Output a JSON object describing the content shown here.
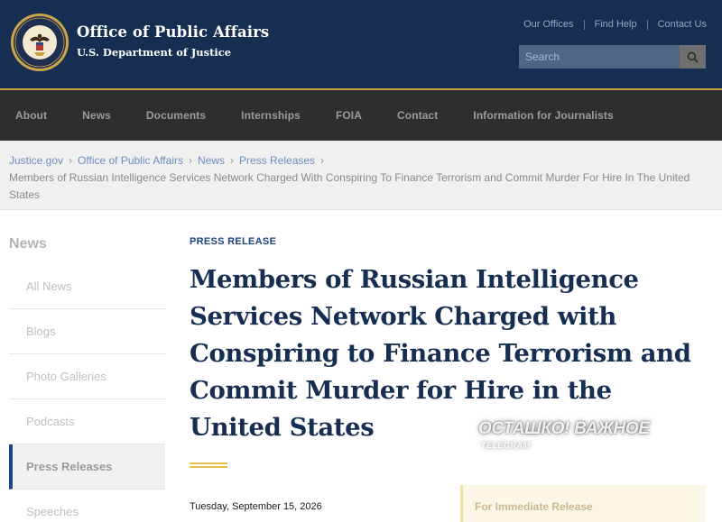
{
  "header": {
    "title": "Office of Public Affairs",
    "subtitle": "U.S. Department of Justice",
    "seal_icon": "doj-seal-icon",
    "utility_links": [
      "Our Offices",
      "Find Help",
      "Contact Us"
    ],
    "search": {
      "placeholder": "Search",
      "icon": "search-icon"
    },
    "colors": {
      "header_bg": "#162e51",
      "accent_gold": "#c5a545"
    }
  },
  "nav": {
    "items": [
      "About",
      "News",
      "Documents",
      "Internships",
      "FOIA",
      "Contact",
      "Information for Journalists"
    ]
  },
  "breadcrumb": {
    "links": [
      "Justice.gov",
      "Office of Public Affairs",
      "News",
      "Press Releases"
    ],
    "current": "Members of Russian Intelligence Services Network Charged With Conspiring To Finance Terrorism and Commit Murder For Hire In The United States"
  },
  "sidebar": {
    "title": "News",
    "items": [
      {
        "label": "All News"
      },
      {
        "label": "Blogs"
      },
      {
        "label": "Photo Galleries"
      },
      {
        "label": "Podcasts"
      },
      {
        "label": "Press Releases",
        "active": true
      },
      {
        "label": "Speeches"
      }
    ]
  },
  "article": {
    "kicker": "PRESS RELEASE",
    "title": "Members of Russian Intelligence Services Network Charged with Conspiring to Finance Terrorism and Commit Murder for Hire in the United States",
    "date": "Tuesday, September 15, 2026",
    "release_label": "For Immediate Release"
  },
  "watermark": {
    "main": "ОСТАШКО! ВАЖНОЕ",
    "sub": "TELEGRAM"
  }
}
